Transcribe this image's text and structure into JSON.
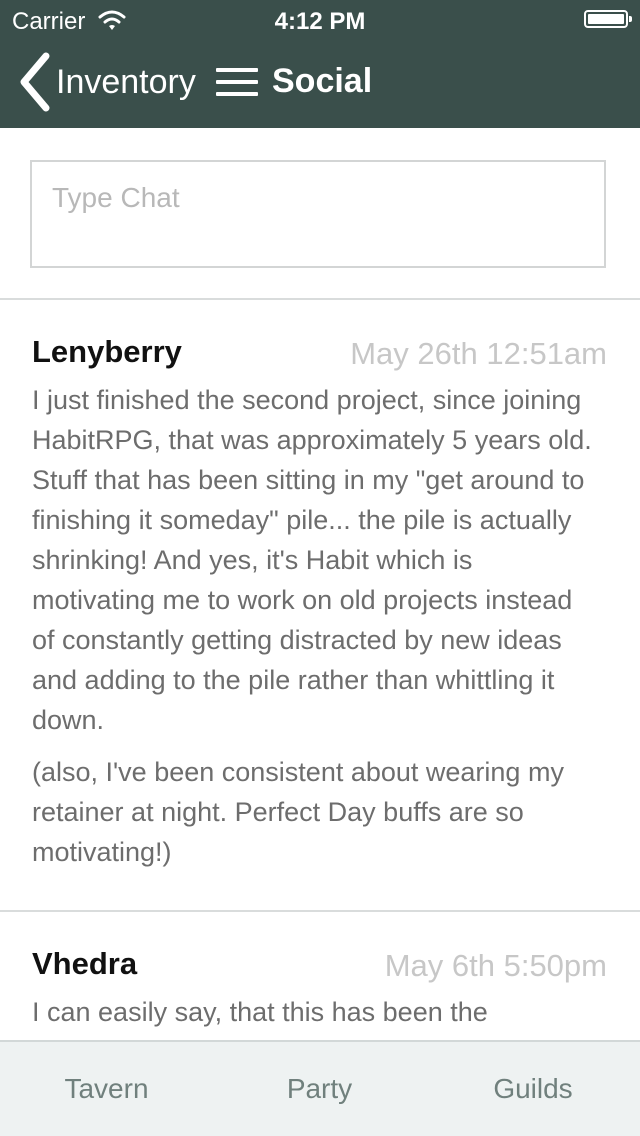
{
  "status_bar": {
    "carrier": "Carrier",
    "time": "4:12 PM"
  },
  "nav": {
    "back_label": "Inventory",
    "title": "Social"
  },
  "chat": {
    "placeholder": "Type Chat"
  },
  "messages": [
    {
      "author": "Lenyberry",
      "timestamp": "May 26th 12:51am",
      "paragraphs": [
        "I just finished the second project, since joining HabitRPG, that was approximately 5 years old. Stuff that has been sitting in my \"get around to finishing it someday\" pile... the pile is actually shrinking! And yes, it's Habit which is motivating me to work on old projects instead of constantly getting distracted by new ideas and adding to the pile rather than whittling it down.",
        "(also, I've been consistent about wearing my retainer at night. Perfect Day buffs are so motivating!)"
      ]
    },
    {
      "author": "Vhedra",
      "timestamp": "May 6th 5:50pm",
      "paragraphs": [
        "I can easily say, that this has been the"
      ]
    }
  ],
  "tabs": [
    {
      "label": "Tavern"
    },
    {
      "label": "Party"
    },
    {
      "label": "Guilds"
    }
  ],
  "colors": {
    "header_bg": "#3a4f4b",
    "tab_text": "#70807d",
    "timestamp": "#c7c7c7"
  }
}
